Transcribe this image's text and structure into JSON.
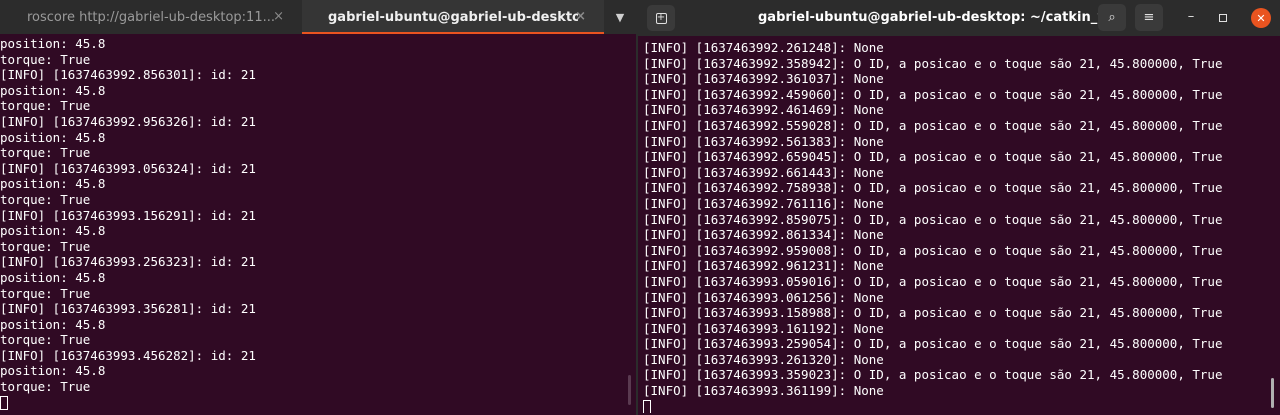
{
  "left": {
    "tabs": [
      {
        "label": "roscore http://gabriel-ub-desktop:11...",
        "active": false
      },
      {
        "label": "gabriel-ubuntu@gabriel-ub-desktop: ...",
        "active": true
      }
    ],
    "tab_close_glyph": "×",
    "tab_menu_glyph": "▼",
    "lines": [
      "position: 45.8",
      "torque: True",
      "[INFO] [1637463992.856301]: id: 21",
      "position: 45.8",
      "torque: True",
      "[INFO] [1637463992.956326]: id: 21",
      "position: 45.8",
      "torque: True",
      "[INFO] [1637463993.056324]: id: 21",
      "position: 45.8",
      "torque: True",
      "[INFO] [1637463993.156291]: id: 21",
      "position: 45.8",
      "torque: True",
      "[INFO] [1637463993.256323]: id: 21",
      "position: 45.8",
      "torque: True",
      "[INFO] [1637463993.356281]: id: 21",
      "position: 45.8",
      "torque: True",
      "[INFO] [1637463993.456282]: id: 21",
      "position: 45.8",
      "torque: True"
    ]
  },
  "right": {
    "title": "gabriel-ubuntu@gabriel-ub-desktop: ~/catkin_ws",
    "icons": {
      "new_tab": "+",
      "search": "⌕",
      "menu": "≡",
      "minimize": "–",
      "close": "✕"
    },
    "lines": [
      "[INFO] [1637463992.261248]: None",
      "[INFO] [1637463992.358942]: O ID, a posicao e o toque são 21, 45.800000, True",
      "[INFO] [1637463992.361037]: None",
      "[INFO] [1637463992.459060]: O ID, a posicao e o toque são 21, 45.800000, True",
      "[INFO] [1637463992.461469]: None",
      "[INFO] [1637463992.559028]: O ID, a posicao e o toque são 21, 45.800000, True",
      "[INFO] [1637463992.561383]: None",
      "[INFO] [1637463992.659045]: O ID, a posicao e o toque são 21, 45.800000, True",
      "[INFO] [1637463992.661443]: None",
      "[INFO] [1637463992.758938]: O ID, a posicao e o toque são 21, 45.800000, True",
      "[INFO] [1637463992.761116]: None",
      "[INFO] [1637463992.859075]: O ID, a posicao e o toque são 21, 45.800000, True",
      "[INFO] [1637463992.861334]: None",
      "[INFO] [1637463992.959008]: O ID, a posicao e o toque são 21, 45.800000, True",
      "[INFO] [1637463992.961231]: None",
      "[INFO] [1637463993.059016]: O ID, a posicao e o toque são 21, 45.800000, True",
      "[INFO] [1637463993.061256]: None",
      "[INFO] [1637463993.158988]: O ID, a posicao e o toque são 21, 45.800000, True",
      "[INFO] [1637463993.161192]: None",
      "[INFO] [1637463993.259054]: O ID, a posicao e o toque são 21, 45.800000, True",
      "[INFO] [1637463993.261320]: None",
      "[INFO] [1637463993.359023]: O ID, a posicao e o toque são 21, 45.800000, True",
      "[INFO] [1637463993.361199]: None"
    ]
  },
  "colors": {
    "terminal_bg": "#300a24",
    "accent": "#e95420",
    "text": "#ffffff"
  }
}
